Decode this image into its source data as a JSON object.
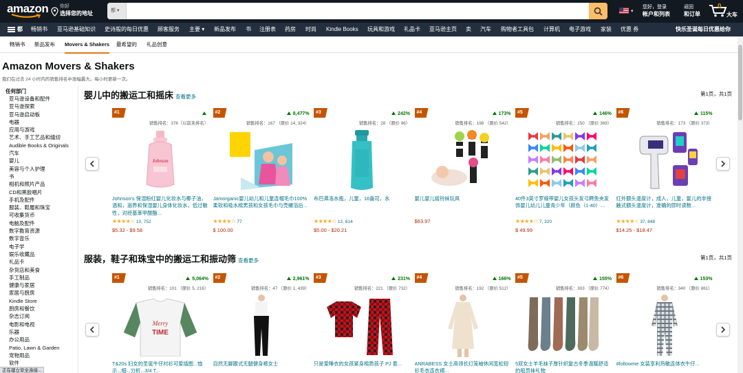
{
  "header": {
    "logo_text": "amazon",
    "deliver_line1": "你好",
    "deliver_line2": "选择您的地址",
    "search_category": "都",
    "search_value": "",
    "search_placeholder": "",
    "lang": "",
    "account_line1": "您好，登录",
    "account_line2": "帐户和列表",
    "returns_line1": "返回",
    "returns_line2": "和订单",
    "cart_count": "0",
    "cart_label": "大车"
  },
  "nav": {
    "all_label": "都",
    "items": [
      "畅销书",
      "亚马逊基础知识",
      "史诗般的每日优惠",
      "顾客服务",
      "主要",
      "新品发布",
      "书",
      "注册表",
      "药房",
      "时尚",
      "Kindle Books",
      "玩具和游戏",
      "礼品卡",
      "亚马逊主页",
      "卖",
      "汽车",
      "购物者工具包",
      "计算机",
      "电子游戏",
      "家装",
      "优惠 券"
    ],
    "promo": "快乐圣诞每日优惠给你"
  },
  "subnav": {
    "tabs": [
      "畅销书",
      "新品发布",
      "Movers & Shakers",
      "最希望的",
      "礼品创意"
    ]
  },
  "page": {
    "title": "Amazon Movers & Shakers",
    "subtitle": "我们在过去 24 小时内的销售排名中涨幅最大。每小时更新一次。"
  },
  "sidebar": {
    "heading": "任何部门",
    "items": [
      "亚马逊设备和配件",
      "亚马逊探索",
      "亚马逊启动板",
      "电器",
      "应用与游戏",
      "艺术、手工艺品和缝纫",
      "Audible Books & Originals",
      "汽车",
      "婴儿",
      "美容与个人护理",
      "书",
      "相机和照片产品",
      "CD和黑胶唱片",
      "手机及配件",
      "服装、鞋履和珠宝",
      "可收集货币",
      "电脑及配件",
      "数字教育资源",
      "数字音乐",
      "电子学",
      "娱乐收藏品",
      "礼品卡",
      "杂货店和美食",
      "手工制品",
      "健康与家居",
      "家居与厨房",
      "Kindle Store",
      "厨房和餐饮",
      "杂志订阅",
      "电影和电视",
      "乐器",
      "办公用品",
      "Patio, Lawn & Garden",
      "宠物用品",
      "软件"
    ]
  },
  "sections": [
    {
      "title": "婴儿中的搬运工和摇床",
      "see_more": "查看更多",
      "page_info": "第1页，共1页",
      "products": [
        {
          "rank": "#1",
          "pct": "",
          "rank_line": "销售排名：376（以前未排名）",
          "title": "Johnson's 保湿粉红婴儿化妆水与椰子油，温和，滋养和保湿婴儿身体化妆水，低过敏性，对经基苯甲酸酯...",
          "rating_count": "10, 752",
          "price": "$5.32 - $9.58",
          "icon": "lotion-bottle-image"
        },
        {
          "rank": "#2",
          "pct": "8,477%",
          "rank_line": "销售排名：167 （原价 14, 324）",
          "title": "Jamorganic婴儿幼儿和儿童连帽毛巾100%柔软和吸水棉男孩和女孩毛巾与壳螺浴后...",
          "rating_count": "77",
          "price": "$ 100.00",
          "icon": "hooded-towel-image"
        },
        {
          "rank": "#3",
          "pct": "242%",
          "rank_line": "销售排名：28 （原价 96）",
          "title": "布巴弗洛水瓶，儿童，16盎司，水",
          "rating_count": "12, 614",
          "price": "$5.00 - $20.21",
          "icon": "water-bottle-image"
        },
        {
          "rank": "#4",
          "pct": "173%",
          "rank_line": "销售排名：198 （原价 542）",
          "title": "婴儿婴儿摇铃袜玩具",
          "rating_count": "",
          "price": "$63.97",
          "icon": "rattle-socks-image"
        },
        {
          "rank": "#5",
          "pct": "146%",
          "rank_line": "销售排名：150 （原价 369）",
          "title": "40件3英寸罗缎带婴儿女孩头发弓鳄鱼夹发饰婴儿幼儿儿童青少年（颜色（1-40）...",
          "rating_count": "7, 320",
          "price": "$ 49.99",
          "icon": "hair-bows-image"
        },
        {
          "rank": "#6",
          "pct": "115%",
          "rank_line": "销售排名：173 （原价 373）",
          "title": "红外额头温度计，成人，儿童，婴儿的非接触式额头温度计，准确的即时读数...",
          "rating_count": "37, 848",
          "price": "$14.25 - $18.47",
          "icon": "thermometer-image"
        }
      ]
    },
    {
      "title": "服装，鞋子和珠宝中的搬运工和振动筛",
      "see_more": "查看更多",
      "page_info": "第1页，共1页",
      "products": [
        {
          "rank": "#1",
          "pct": "5,064%",
          "rank_line": "销售排名：101 （原价 5, 216）",
          "title": "T&20s 妇女的圣诞牛仔衬衫可爱插图...恤示...细...分析...3/4 T...",
          "rating_count": "",
          "price": "",
          "icon": "christmas-shirt-image"
        },
        {
          "rank": "#2",
          "pct": "2,961%",
          "rank_line": "销售排名：47 （原价 1, 439）",
          "title": "自然无脚跟式无腿健身裤女士",
          "rating_count": "2, 142",
          "price": "",
          "icon": "leggings-image"
        },
        {
          "rank": "#3",
          "pct": "231%",
          "rank_line": "销售排名：221 （原价 732）",
          "title": "只是爱睡衣的女孩紧身棉质孩子 PJ 套...",
          "rating_count": "",
          "price": "",
          "icon": "plaid-pajamas-image"
        },
        {
          "rank": "#4",
          "pct": "166%",
          "rank_line": "销售排名：192 （原价 512）",
          "title": "ANRABESS 女士高领长灯笼袖休闲宽松短衫毛衣连衣裙...",
          "rating_count": "",
          "price": "",
          "icon": "sweater-dress-image"
        },
        {
          "rank": "#5",
          "pct": "155%",
          "rank_line": "销售排名：303 （原价 774）",
          "title": "5双女士羊毛袜子厚针织复古冬季温暖舒适的船员袜礼物",
          "rating_count": "",
          "price": "",
          "icon": "wool-socks-image"
        },
        {
          "rank": "#6",
          "pct": "153%",
          "rank_line": "销售排名：340 （原价 861）",
          "title": "#followme 女装享利热敏连体衣牛仔...",
          "rating_count": "",
          "price": "",
          "icon": "onesie-image"
        }
      ]
    }
  ],
  "status": "正在建立安全连接...",
  "colors": {
    "topbar": "#131921",
    "nav": "#232F3E",
    "accent": "#FEBD69",
    "badge": "#C45500",
    "link": "#007185",
    "price": "#B12704",
    "up": "#007600",
    "star": "#FFA41C"
  }
}
